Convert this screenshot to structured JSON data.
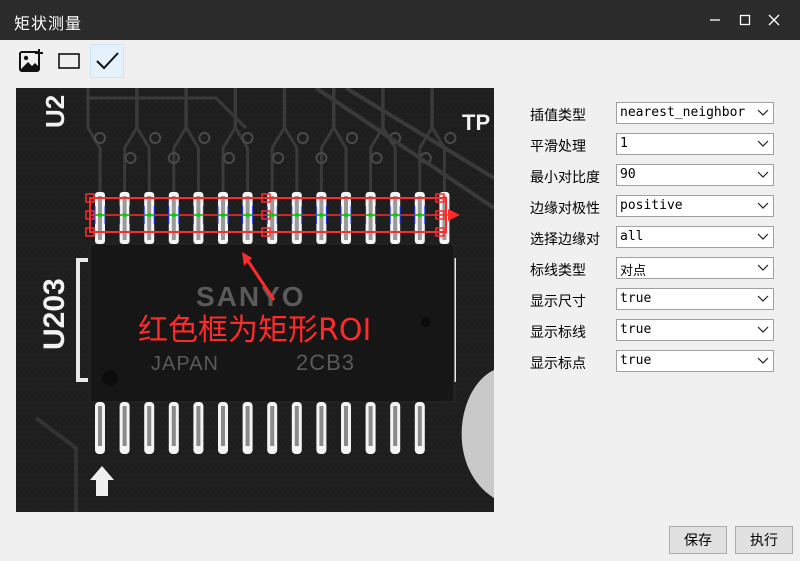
{
  "window": {
    "title": "矩状测量",
    "minimize_icon": "minimize-icon",
    "maximize_icon": "maximize-icon",
    "close_icon": "close-icon"
  },
  "toolbar": {
    "buttons": [
      {
        "icon": "add-image-icon"
      },
      {
        "icon": "rectangle-icon"
      },
      {
        "icon": "checkmark-icon"
      }
    ]
  },
  "viewer": {
    "board_labels": {
      "u203": "U203",
      "top_left": "U2",
      "top_right": "TP"
    },
    "chip": {
      "brand": "SANYO",
      "origin": "JAPAN",
      "code": "2CB3"
    },
    "annotation": "红色框为矩形ROI",
    "colors": {
      "roi": "#ff2a2a",
      "edge_points": "#00d000",
      "edge_lines": "#2233ff"
    }
  },
  "params": [
    {
      "label": "插值类型",
      "value": "nearest_neighbor"
    },
    {
      "label": "平滑处理",
      "value": "1"
    },
    {
      "label": "最小对比度",
      "value": "90"
    },
    {
      "label": "边缘对极性",
      "value": "positive"
    },
    {
      "label": "选择边缘对",
      "value": "all"
    },
    {
      "label": "标线类型",
      "value": "对点"
    },
    {
      "label": "显示尺寸",
      "value": "true"
    },
    {
      "label": "显示标线",
      "value": "true"
    },
    {
      "label": "显示标点",
      "value": "true"
    }
  ],
  "buttons": {
    "save": "保存",
    "run": "执行"
  }
}
